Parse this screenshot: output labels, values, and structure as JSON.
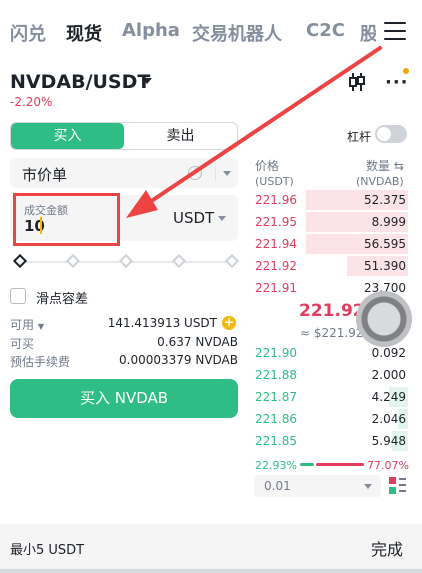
{
  "top_tabs": [
    "闪兑",
    "现货",
    "Alpha",
    "交易机器人",
    "C2C",
    "股"
  ],
  "pair": {
    "symbol": "NVDAB/USDT",
    "change": "-2.20%"
  },
  "leverage": {
    "label": "杠杆"
  },
  "side": {
    "buy": "买入",
    "sell": "卖出"
  },
  "order_type": {
    "label": "市价单",
    "info_glyph": "i"
  },
  "amount": {
    "label": "成交金额",
    "value": "10",
    "unit": "USDT"
  },
  "slider": {
    "level_percent": 0
  },
  "slippage": {
    "label": "滑点容差"
  },
  "balances": [
    {
      "label": "可用",
      "value": "141.413913 USDT"
    },
    {
      "label": "可买",
      "value": "0.637 NVDAB"
    },
    {
      "label": "预估手续费",
      "value": "0.00003379 NVDAB"
    }
  ],
  "buy_button": {
    "label": "买入 NVDAB"
  },
  "order_book": {
    "price_header": "价格",
    "price_unit": "(USDT)",
    "qty_header": "数量 ⇆",
    "qty_unit": "(NVDAB)",
    "asks": [
      {
        "price": "221.96",
        "qty": "52.375",
        "depth": 0.64
      },
      {
        "price": "221.95",
        "qty": "8.999",
        "depth": 0.64
      },
      {
        "price": "221.94",
        "qty": "56.595",
        "depth": 0.64
      },
      {
        "price": "221.92",
        "qty": "51.390",
        "depth": 0.38
      },
      {
        "price": "221.91",
        "qty": "23.700",
        "depth": 0.0
      }
    ],
    "mid_price": "221.92",
    "mid_usd": "≈ $221.92",
    "bids": [
      {
        "price": "221.90",
        "qty": "0.092",
        "depth": 0.0
      },
      {
        "price": "221.88",
        "qty": "2.000",
        "depth": 0.0
      },
      {
        "price": "221.87",
        "qty": "4.249",
        "depth": 0.12
      },
      {
        "price": "221.86",
        "qty": "2.046",
        "depth": 0.06
      },
      {
        "price": "221.85",
        "qty": "5.948",
        "depth": 0.1
      }
    ],
    "buy_ratio": "22.93%",
    "sell_ratio": "77.07%",
    "tick_size": "0.01"
  },
  "footer": {
    "min_label": "最小5 USDT",
    "done_label": "完成"
  },
  "colors": {
    "buy": "#2ebd85",
    "sell": "#e23d5e",
    "highlight": "#ee4343",
    "accent": "#f0b90b"
  }
}
